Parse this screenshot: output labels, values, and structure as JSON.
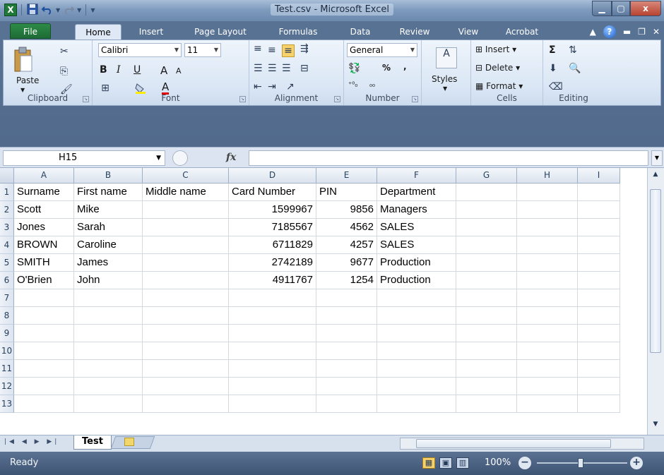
{
  "window": {
    "title": "Test.csv - Microsoft Excel",
    "minimize_icon": "minimize-icon",
    "maximize_icon": "maximize-icon",
    "close_label": "x"
  },
  "quick_access": {
    "logo_label": "X",
    "items": [
      "save-icon",
      "undo-icon",
      "redo-icon",
      "customize-icon"
    ]
  },
  "tabs": [
    "File",
    "Home",
    "Insert",
    "Page Layout",
    "Formulas",
    "Data",
    "Review",
    "View",
    "Acrobat"
  ],
  "ribbon": {
    "clipboard": {
      "label": "Clipboard",
      "paste": "Paste"
    },
    "font": {
      "label": "Font",
      "name": "Calibri",
      "size": "11",
      "bold": "B",
      "italic": "I",
      "underline": "U",
      "grow": "A",
      "shrink": "A",
      "color_a": "A"
    },
    "alignment": {
      "label": "Alignment"
    },
    "number": {
      "label": "Number",
      "format": "General",
      "percent": "%",
      "comma": ",",
      "inc": "⁺⁰₀",
      "dec": "₀₀"
    },
    "styles": {
      "label": "Styles"
    },
    "cells": {
      "label": "Cells",
      "insert": "Insert",
      "delete": "Delete",
      "format": "Format"
    },
    "editing": {
      "label": "Editing",
      "sigma": "Σ"
    }
  },
  "formula_bar": {
    "name_box": "H15",
    "fx": "fx",
    "value": ""
  },
  "columns": [
    "A",
    "B",
    "C",
    "D",
    "E",
    "F",
    "G",
    "H",
    "I"
  ],
  "rows": [
    "1",
    "2",
    "3",
    "4",
    "5",
    "6",
    "7",
    "8",
    "9",
    "10",
    "11",
    "12",
    "13"
  ],
  "table": {
    "header": [
      "Surname",
      "First name",
      "Middle name",
      "Card Number",
      "PIN",
      "Department"
    ],
    "data": [
      [
        "Scott",
        "Mike",
        "",
        "1599967",
        "9856",
        "Managers"
      ],
      [
        "Jones",
        "Sarah",
        "",
        "7185567",
        "4562",
        "SALES"
      ],
      [
        "BROWN",
        "Caroline",
        "",
        "6711829",
        "4257",
        "SALES"
      ],
      [
        "SMITH",
        "James",
        "",
        "2742189",
        "9677",
        "Production"
      ],
      [
        "O'Brien",
        "John",
        "",
        "4911767",
        "1254",
        "Production"
      ]
    ]
  },
  "sheet_tabs": [
    "Test"
  ],
  "status": {
    "ready": "Ready",
    "zoom": "100%",
    "zoom_minus": "−",
    "zoom_plus": "+"
  },
  "colors": {
    "title_bar": "#7f9cbf",
    "file_tab": "#1d6b35",
    "status_bar": "#3e5473",
    "grid_line": "#d4d9e0"
  }
}
